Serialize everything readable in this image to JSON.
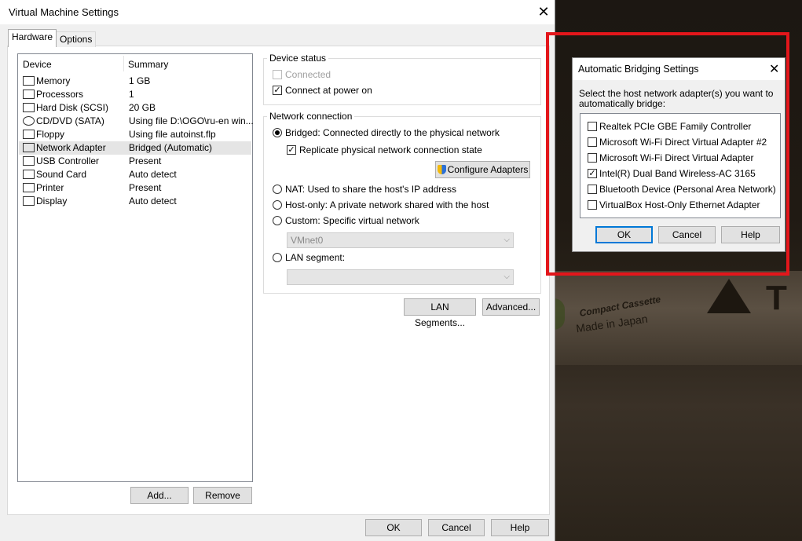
{
  "window": {
    "title": "Virtual Machine Settings",
    "tabs": [
      "Hardware",
      "Options"
    ],
    "device_header": "Device",
    "summary_header": "Summary",
    "devices": [
      {
        "name": "Memory",
        "summary": "1 GB",
        "icon": "memory-icon"
      },
      {
        "name": "Processors",
        "summary": "1",
        "icon": "processor-icon"
      },
      {
        "name": "Hard Disk (SCSI)",
        "summary": "20 GB",
        "icon": "harddisk-icon"
      },
      {
        "name": "CD/DVD (SATA)",
        "summary": "Using file D:\\OGO\\ru-en win...",
        "icon": "cd-icon"
      },
      {
        "name": "Floppy",
        "summary": "Using file autoinst.flp",
        "icon": "floppy-icon"
      },
      {
        "name": "Network Adapter",
        "summary": "Bridged (Automatic)",
        "icon": "network-icon"
      },
      {
        "name": "USB Controller",
        "summary": "Present",
        "icon": "usb-icon"
      },
      {
        "name": "Sound Card",
        "summary": "Auto detect",
        "icon": "speaker-icon"
      },
      {
        "name": "Printer",
        "summary": "Present",
        "icon": "printer-icon"
      },
      {
        "name": "Display",
        "summary": "Auto detect",
        "icon": "monitor-icon"
      }
    ],
    "add_label": "Add...",
    "remove_label": "Remove",
    "device_status": {
      "title": "Device status",
      "connected": "Connected",
      "connect_power": "Connect at power on"
    },
    "network": {
      "title": "Network connection",
      "bridged": "Bridged: Connected directly to the physical network",
      "replicate": "Replicate physical network connection state",
      "configure": "Configure Adapters",
      "nat": "NAT: Used to share the host's IP address",
      "hostonly": "Host-only: A private network shared with the host",
      "custom": "Custom: Specific virtual network",
      "vmnet": "VMnet0",
      "lan": "LAN segment:"
    },
    "lan_segments_label": "LAN Segments...",
    "advanced_label": "Advanced...",
    "ok_label": "OK",
    "cancel_label": "Cancel",
    "help_label": "Help"
  },
  "dialog": {
    "title": "Automatic Bridging Settings",
    "instruction_line1": "Select the host network adapter(s) you want to",
    "instruction_line2": "automatically bridge:",
    "adapters": [
      {
        "name": "Realtek PCIe GBE Family Controller",
        "checked": false
      },
      {
        "name": "Microsoft Wi-Fi Direct Virtual Adapter #2",
        "checked": false
      },
      {
        "name": "Microsoft Wi-Fi Direct Virtual Adapter",
        "checked": false
      },
      {
        "name": "Intel(R) Dual Band Wireless-AC 3165",
        "checked": true
      },
      {
        "name": "Bluetooth Device (Personal Area Network)",
        "checked": false
      },
      {
        "name": "VirtualBox Host-Only Ethernet Adapter",
        "checked": false
      }
    ],
    "ok_label": "OK",
    "cancel_label": "Cancel",
    "help_label": "Help"
  },
  "background": {
    "brand_text": "Compact Cassette",
    "made_in": "Made in Japan",
    "logo_letter": "T"
  },
  "colors": {
    "highlight_red": "#e3161b",
    "focus_blue": "#0078d7"
  }
}
